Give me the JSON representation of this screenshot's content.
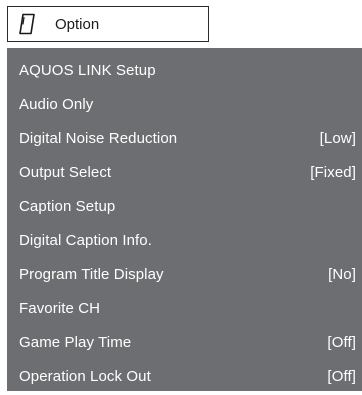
{
  "tab": {
    "label": "Option",
    "icon": "option-card-icon"
  },
  "menu": {
    "items": [
      {
        "label": "AQUOS LINK Setup",
        "value": ""
      },
      {
        "label": "Audio Only",
        "value": ""
      },
      {
        "label": "Digital Noise Reduction",
        "value": "[Low]"
      },
      {
        "label": "Output Select",
        "value": "[Fixed]"
      },
      {
        "label": "Caption Setup",
        "value": ""
      },
      {
        "label": "Digital Caption Info.",
        "value": ""
      },
      {
        "label": "Program Title Display",
        "value": "[No]"
      },
      {
        "label": "Favorite CH",
        "value": ""
      },
      {
        "label": "Game Play Time",
        "value": "[Off]"
      },
      {
        "label": "Operation Lock Out",
        "value": "[Off]"
      }
    ]
  },
  "colors": {
    "menu_background": "#6d6e71",
    "text": "#ffffff"
  }
}
